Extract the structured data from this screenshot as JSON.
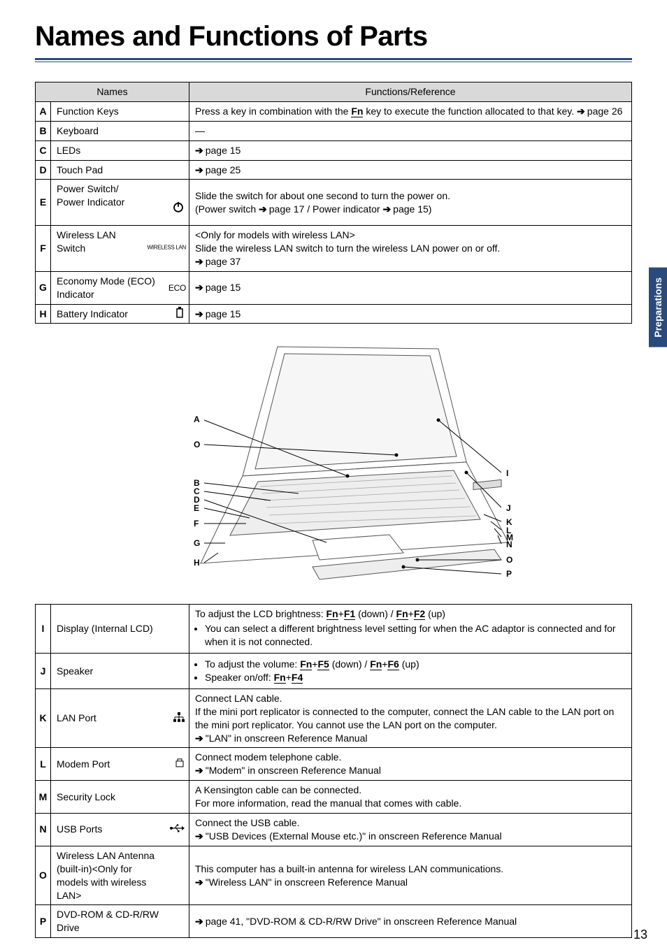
{
  "title": "Names and Functions of Parts",
  "sideTab": "Preparations",
  "pageNumber": "13",
  "headers": {
    "names": "Names",
    "functions": "Functions/Reference"
  },
  "rowsTop": [
    {
      "idx": "A",
      "name": "Function Keys",
      "func": {
        "pre": "Press a key in combination with the ",
        "key": "Fn",
        "post": " key to execute the function allocated to that key. ",
        "arrow": "page 26"
      }
    },
    {
      "idx": "B",
      "name": "Keyboard",
      "func": {
        "plain": "—"
      }
    },
    {
      "idx": "C",
      "name": "LEDs",
      "func": {
        "arrow": "page 15"
      }
    },
    {
      "idx": "D",
      "name": "Touch Pad",
      "func": {
        "arrow": "page 25"
      }
    },
    {
      "idx": "E",
      "name": "Power Switch/\nPower Indicator",
      "icon": "power-icon",
      "func": {
        "line1": "Slide the switch for about one second to turn the power on.",
        "line2a": "(Power switch ",
        "arrow1": "page 17",
        "mid": " / Power indicator ",
        "arrow2": "page 15",
        "line2b": ")"
      }
    },
    {
      "idx": "F",
      "name": "Wireless LAN\nSwitch",
      "label": "WIRELESS LAN",
      "func": {
        "line1": "<Only for models with wireless LAN>",
        "line2": "Slide the wireless LAN switch to turn the wireless LAN power on or off.",
        "arrow": "page 37"
      }
    },
    {
      "idx": "G",
      "name": "Economy Mode (ECO) Indicator",
      "label": "ECO",
      "func": {
        "arrow": "page 15"
      }
    },
    {
      "idx": "H",
      "name": "Battery Indicator",
      "icon": "battery-icon",
      "func": {
        "arrow": "page 15"
      }
    }
  ],
  "rowsBottom": [
    {
      "idx": "I",
      "name": "Display (Internal LCD)",
      "func": {
        "pre": "To adjust the LCD brightness: ",
        "keys": [
          [
            "Fn",
            "F1"
          ],
          [
            "Fn",
            "F2"
          ]
        ],
        "keysLabels": [
          " (down) / ",
          " (up)"
        ],
        "bullet": "You can select a different brightness level setting for when the AC adaptor is connected and for when it is not connected."
      }
    },
    {
      "idx": "J",
      "name": "Speaker",
      "func": {
        "bullets": [
          {
            "pre": "To adjust the volume: ",
            "keys": [
              [
                "Fn",
                "F5"
              ],
              [
                "Fn",
                "F6"
              ]
            ],
            "keysLabels": [
              " (down) / ",
              " (up)"
            ]
          },
          {
            "pre": "Speaker on/off: ",
            "keys": [
              [
                "Fn",
                "F4"
              ]
            ],
            "keysLabels": [
              ""
            ]
          }
        ]
      }
    },
    {
      "idx": "K",
      "name": "LAN Port",
      "icon": "lan-icon",
      "func": {
        "line1": "Connect LAN cable.",
        "line2": "If the mini port replicator is connected to the computer, connect the LAN cable to the LAN port on the mini port replicator. You cannot use the LAN port on the computer.",
        "arrowText": "\"LAN\" in onscreen Reference Manual"
      }
    },
    {
      "idx": "L",
      "name": "Modem Port",
      "icon": "modem-icon",
      "func": {
        "line1": "Connect modem telephone cable.",
        "arrowText": "\"Modem\" in onscreen Reference Manual"
      }
    },
    {
      "idx": "M",
      "name": "Security Lock",
      "func": {
        "line1": "A Kensington cable can be connected.",
        "line2": "For more information, read the manual that comes with cable."
      }
    },
    {
      "idx": "N",
      "name": "USB Ports",
      "icon": "usb-icon",
      "func": {
        "line1": "Connect the USB cable.",
        "arrowText": "\"USB Devices (External Mouse etc.)\" in onscreen Reference Manual"
      }
    },
    {
      "idx": "O",
      "name": "Wireless LAN Antenna (built-in)<Only for models with wireless LAN>",
      "func": {
        "line1": "This computer has a built-in antenna for wireless LAN communications.",
        "arrowText": "\"Wireless LAN\" in onscreen Reference Manual"
      }
    },
    {
      "idx": "P",
      "name": "DVD-ROM & CD-R/RW Drive",
      "func": {
        "arrowText": "page 41, \"DVD-ROM & CD-R/RW Drive\" in onscreen Reference Manual"
      }
    }
  ],
  "diagramLabels": [
    "A",
    "B",
    "C",
    "D",
    "E",
    "F",
    "G",
    "H",
    "I",
    "J",
    "K",
    "L",
    "M",
    "N",
    "O",
    "O",
    "P"
  ]
}
